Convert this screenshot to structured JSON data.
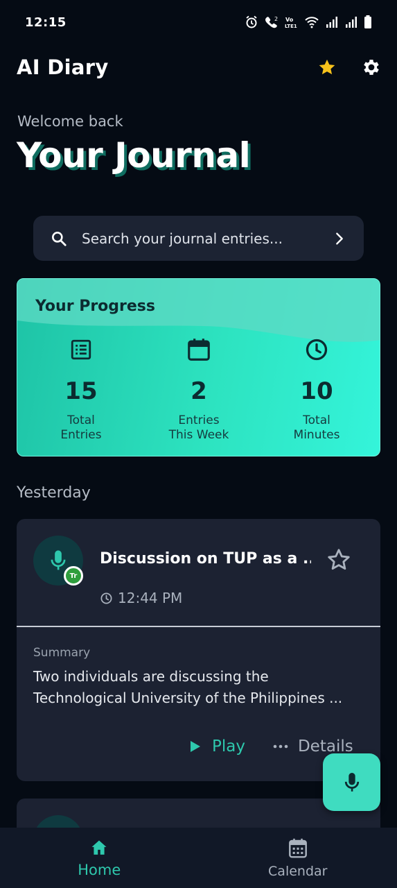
{
  "status_bar": {
    "time": "12:15",
    "icons": [
      "alarm-icon",
      "call-icon",
      "volte-icon",
      "wifi-icon",
      "signal-icon",
      "signal-icon",
      "battery-icon"
    ],
    "volte_label": "Vo LTE1"
  },
  "app_bar": {
    "title": "AI Diary",
    "favorites_icon": "star-icon",
    "settings_icon": "gear-icon"
  },
  "header": {
    "welcome": "Welcome back",
    "title": "Your Journal"
  },
  "search": {
    "placeholder": "Search your journal entries..."
  },
  "progress": {
    "title": "Your Progress",
    "stats": [
      {
        "icon": "list-icon",
        "value": "15",
        "label": "Total Entries"
      },
      {
        "icon": "calendar-icon",
        "value": "2",
        "label": "Entries This Week"
      },
      {
        "icon": "clock-icon",
        "value": "10",
        "label": "Total Minutes"
      }
    ]
  },
  "section": {
    "label": "Yesterday"
  },
  "entries": [
    {
      "title": "Discussion on TUP as a ...",
      "time": "12:44 PM",
      "badge": "Tr",
      "summary_label": "Summary",
      "summary": "Two individuals are discussing the Technological University of the Philippines ...",
      "play_label": "Play",
      "details_label": "Details"
    }
  ],
  "bottom_nav": {
    "items": [
      {
        "label": "Home",
        "icon": "home-icon",
        "active": true
      },
      {
        "label": "Calendar",
        "icon": "calendar-icon",
        "active": false
      }
    ]
  },
  "colors": {
    "background": "#050b14",
    "card": "#1c2232",
    "accent": "#2ec8ad",
    "star": "#f7c21b"
  }
}
